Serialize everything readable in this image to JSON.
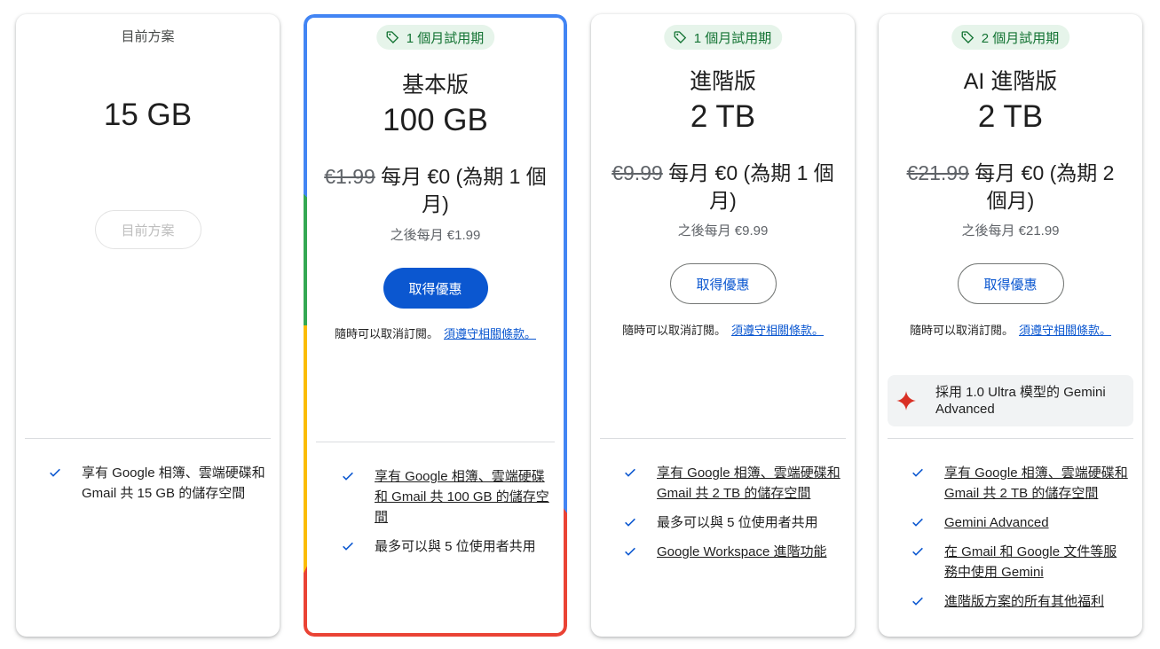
{
  "colors": {
    "accent": "#0b57d0",
    "trial_badge_bg": "#e6f4ea",
    "trial_badge_text": "#137333",
    "gemini_star": "#d93025"
  },
  "plans": [
    {
      "current_label": "目前方案",
      "storage": "15 GB",
      "button": "目前方案",
      "features": [
        "享有 Google 相簿、雲端硬碟和 Gmail 共 15 GB 的儲存空間"
      ]
    },
    {
      "badge": "1 個月試用期",
      "name": "基本版",
      "storage": "100 GB",
      "price_old": "€1.99",
      "price_new": "每月 €0 (為期 1 個月)",
      "price_after": "之後每月 €1.99",
      "button": "取得優惠",
      "cancel_text": "隨時可以取消訂閱。",
      "terms_link": "須遵守相關條款。",
      "features": [
        "享有 Google 相簿、雲端硬碟和 Gmail 共 100 GB 的儲存空間",
        "最多可以與 5 位使用者共用"
      ]
    },
    {
      "badge": "1 個月試用期",
      "name": "進階版",
      "storage": "2 TB",
      "price_old": "€9.99",
      "price_new": "每月 €0 (為期 1 個月)",
      "price_after": "之後每月 €9.99",
      "button": "取得優惠",
      "cancel_text": "隨時可以取消訂閱。",
      "terms_link": "須遵守相關條款。",
      "features": [
        "享有 Google 相簿、雲端硬碟和 Gmail 共 2 TB 的儲存空間",
        "最多可以與 5 位使用者共用",
        "Google Workspace 進階功能"
      ]
    },
    {
      "badge": "2 個月試用期",
      "name": "AI 進階版",
      "storage": "2 TB",
      "price_old": "€21.99",
      "price_new": "每月 €0 (為期 2 個月)",
      "price_after": "之後每月 €21.99",
      "button": "取得優惠",
      "cancel_text": "隨時可以取消訂閱。",
      "terms_link": "須遵守相關條款。",
      "gemini_highlight": "採用 1.0 Ultra 模型的 Gemini Advanced",
      "features": [
        "享有 Google 相簿、雲端硬碟和 Gmail 共 2 TB 的儲存空間",
        "Gemini Advanced",
        "在 Gmail 和 Google 文件等服務中使用 Gemini",
        "進階版方案的所有其他福利"
      ]
    }
  ]
}
